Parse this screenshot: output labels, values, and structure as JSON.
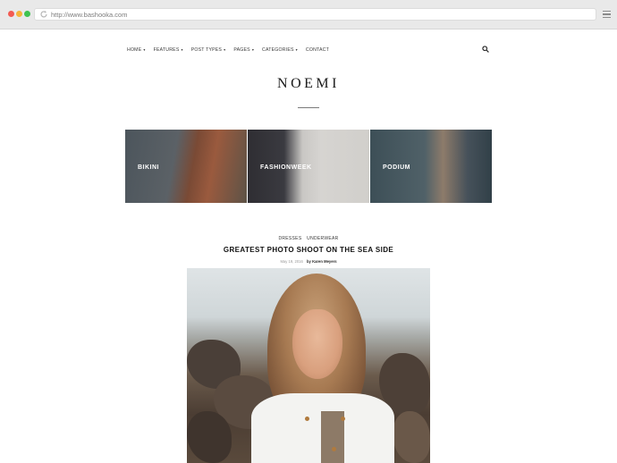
{
  "browser": {
    "url": "http://www.bashooka.com"
  },
  "nav": {
    "items": [
      {
        "label": "HOME",
        "has_caret": true
      },
      {
        "label": "FEATURES",
        "has_caret": true
      },
      {
        "label": "POST TYPES",
        "has_caret": true
      },
      {
        "label": "PAGES",
        "has_caret": true
      },
      {
        "label": "CATEGORIES",
        "has_caret": true
      },
      {
        "label": "CONTACT",
        "has_caret": false
      }
    ],
    "caret": "▾"
  },
  "site": {
    "logo": "NOEMI"
  },
  "tiles": [
    {
      "label": "BIKINI"
    },
    {
      "label": "FASHIONWEEK"
    },
    {
      "label": "PODIUM"
    }
  ],
  "post": {
    "categories": [
      "DRESSES",
      "UNDERWEAR"
    ],
    "title": "GREATEST PHOTO SHOOT ON THE SEA SIDE",
    "date": "May 19, 2016",
    "by_label": "by",
    "author": "Karen Meyers"
  },
  "icons": {
    "reload": "reload-icon",
    "menu": "hamburger-menu-icon",
    "search": "search-icon"
  },
  "colors": {
    "chrome": "#e9e9e9",
    "close": "#f25b52",
    "minimize": "#f6b53a",
    "maximize": "#3fc350"
  }
}
